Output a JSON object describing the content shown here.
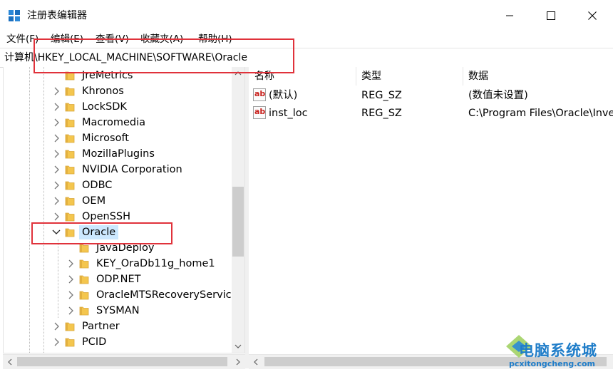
{
  "window": {
    "title": "注册表编辑器",
    "icon": "regedit-icon"
  },
  "menubar": {
    "items": [
      "文件(F)",
      "编辑(E)",
      "查看(V)",
      "收藏夹(A)",
      "帮助(H)"
    ]
  },
  "address": {
    "path": "计算机\\HKEY_LOCAL_MACHINE\\SOFTWARE\\Oracle"
  },
  "tree": {
    "nodes": [
      {
        "label": "JreMetrics",
        "depth": 1,
        "expander": "none"
      },
      {
        "label": "Khronos",
        "depth": 1,
        "expander": "collapsed"
      },
      {
        "label": "LockSDK",
        "depth": 1,
        "expander": "collapsed"
      },
      {
        "label": "Macromedia",
        "depth": 1,
        "expander": "collapsed"
      },
      {
        "label": "Microsoft",
        "depth": 1,
        "expander": "collapsed"
      },
      {
        "label": "MozillaPlugins",
        "depth": 1,
        "expander": "collapsed"
      },
      {
        "label": "NVIDIA Corporation",
        "depth": 1,
        "expander": "collapsed"
      },
      {
        "label": "ODBC",
        "depth": 1,
        "expander": "collapsed"
      },
      {
        "label": "OEM",
        "depth": 1,
        "expander": "collapsed"
      },
      {
        "label": "OpenSSH",
        "depth": 1,
        "expander": "collapsed"
      },
      {
        "label": "Oracle",
        "depth": 1,
        "expander": "expanded",
        "selected": true
      },
      {
        "label": "JavaDeploy",
        "depth": 2,
        "expander": "none"
      },
      {
        "label": "KEY_OraDb11g_home1",
        "depth": 2,
        "expander": "collapsed"
      },
      {
        "label": "ODP.NET",
        "depth": 2,
        "expander": "collapsed"
      },
      {
        "label": "OracleMTSRecoveryServic",
        "depth": 2,
        "expander": "collapsed"
      },
      {
        "label": "SYSMAN",
        "depth": 2,
        "expander": "collapsed"
      },
      {
        "label": "Partner",
        "depth": 1,
        "expander": "collapsed"
      },
      {
        "label": "PCID",
        "depth": 1,
        "expander": "collapsed"
      }
    ]
  },
  "list": {
    "columns": [
      "名称",
      "类型",
      "数据"
    ],
    "rows": [
      {
        "name": "(默认)",
        "type": "REG_SZ",
        "data": "(数值未设置)",
        "icon": "string-value-icon"
      },
      {
        "name": "inst_loc",
        "type": "REG_SZ",
        "data": "C:\\Program Files\\Oracle\\Inve",
        "icon": "string-value-icon"
      }
    ]
  },
  "watermark": {
    "title": "电脑系统城",
    "site": "pcxitongcheng.com"
  },
  "colors": {
    "annotation": "#e0323b",
    "selection": "#cce8ff",
    "folder": "#f4c64e",
    "watermark": "#1f7dc9"
  }
}
